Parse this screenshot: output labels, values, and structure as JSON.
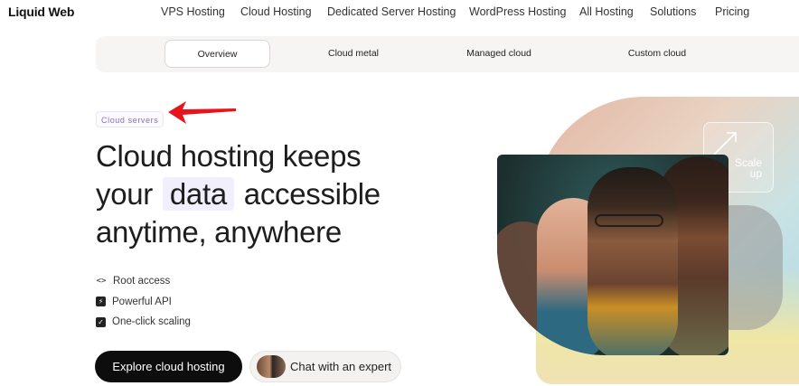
{
  "brand": {
    "logo_text": "Liquid Web"
  },
  "topnav": {
    "items": [
      "VPS Hosting",
      "Cloud Hosting",
      "Dedicated Server Hosting",
      "WordPress Hosting",
      "All Hosting",
      "Solutions",
      "Pricing"
    ]
  },
  "subnav": {
    "tabs": [
      "Overview",
      "Cloud metal",
      "Managed cloud",
      "Custom cloud"
    ],
    "active": "Overview"
  },
  "hero": {
    "badge": "Cloud servers",
    "headline_line1": "Cloud hosting keeps",
    "headline_line2_pre": "your",
    "headline_highlight": "data",
    "headline_line2_post": "accessible",
    "headline_line3": "anytime, anywhere",
    "features": [
      {
        "icon": "code-icon",
        "label": "Root access"
      },
      {
        "icon": "bolt-icon",
        "label": "Powerful API"
      },
      {
        "icon": "checkbox-icon",
        "label": "One-click scaling"
      }
    ],
    "primary_cta": "Explore cloud hosting",
    "secondary_cta": "Chat with an expert",
    "scale_label_1": "Scale",
    "scale_label_2": "up"
  },
  "colors": {
    "accent_purple": "#8a6cc9",
    "annotation_red": "#e8141b",
    "cta_dark": "#0d0d0d"
  }
}
